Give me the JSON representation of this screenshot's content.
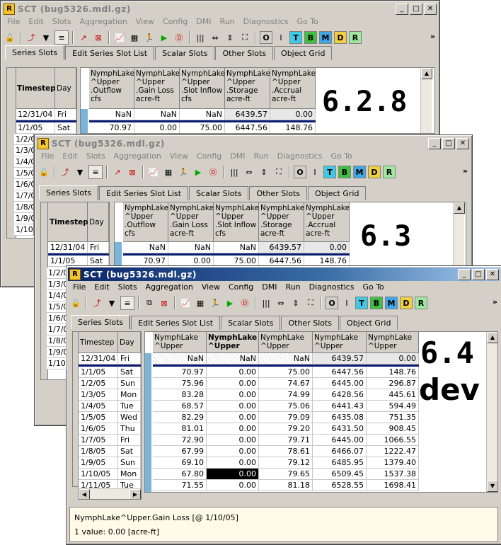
{
  "windows": {
    "w1": {
      "title": "SCT  (bug5326.mdl.gz)",
      "version": "6.2.8"
    },
    "w2": {
      "title": "SCT  (bug5326.mdl.gz)",
      "version": "6.3"
    },
    "w3": {
      "title": "SCT  (bug5326.mdl.gz)",
      "version_line1": "6.4",
      "version_line2": "dev"
    }
  },
  "menu": [
    "File",
    "Edit",
    "Slots",
    "Aggregation",
    "View",
    "Config",
    "DMI",
    "Run",
    "Diagnostics",
    "Go To"
  ],
  "toolbar_letters": [
    "O",
    "I",
    "T",
    "B",
    "M",
    "D",
    "R"
  ],
  "tabs": [
    "Series Slots",
    "Edit Series Slot List",
    "Scalar Slots",
    "Other Slots",
    "Object Grid"
  ],
  "old_headers": {
    "timestep": "Timestep",
    "day": "Day",
    "cols": [
      "NymphLake\n^Upper\n.Outflow\ncfs",
      "NymphLake\n^Upper\n.Gain Loss\nacre-ft",
      "NymphLake\n^Upper\n.Slot Inflow\ncfs",
      "NymphLake\n^Upper\n.Storage\nacre-ft",
      "NymphLake\n^Upper\n.Accrual\nacre-ft"
    ]
  },
  "new_headers": {
    "timestep": "Timestep",
    "day": "Day",
    "cols": [
      "NymphLake\n^Upper",
      "NymphLake\n^Upper",
      "NymphLake\n^Upper",
      "NymphLake\n^Upper",
      "NymphLake\n^Upper"
    ]
  },
  "rows": [
    {
      "ts": "12/31/04",
      "day": "Fri",
      "v": [
        "NaN",
        "NaN",
        "NaN",
        "6439.57",
        "0.00"
      ]
    },
    {
      "ts": "1/1/05",
      "day": "Sat",
      "v": [
        "70.97",
        "0.00",
        "75.00",
        "6447.56",
        "148.76"
      ]
    },
    {
      "ts": "1/2/05",
      "day": "Sun",
      "v": [
        "75.96",
        "0.00",
        "74.67",
        "6445.00",
        "296.87"
      ]
    },
    {
      "ts": "1/3/05",
      "day": "Mon",
      "v": [
        "83.28",
        "0.00",
        "74.99",
        "6428.56",
        "445.61"
      ]
    },
    {
      "ts": "1/4/05",
      "day": "Tue",
      "v": [
        "68.57",
        "0.00",
        "75.06",
        "6441.43",
        "594.49"
      ]
    },
    {
      "ts": "1/5/05",
      "day": "Wed",
      "v": [
        "82.29",
        "0.00",
        "79.09",
        "6435.08",
        "751.35"
      ]
    },
    {
      "ts": "1/6/05",
      "day": "Thu",
      "v": [
        "81.01",
        "0.00",
        "79.20",
        "6431.50",
        "908.45"
      ]
    },
    {
      "ts": "1/7/05",
      "day": "Fri",
      "v": [
        "72.90",
        "0.00",
        "79.71",
        "6445.00",
        "1066.55"
      ]
    },
    {
      "ts": "1/8/05",
      "day": "Sat",
      "v": [
        "67.99",
        "0.00",
        "78.61",
        "6466.07",
        "1222.47"
      ]
    },
    {
      "ts": "1/9/05",
      "day": "Sun",
      "v": [
        "69.10",
        "0.00",
        "79.12",
        "6485.95",
        "1379.40"
      ]
    },
    {
      "ts": "1/10/05",
      "day": "Mon",
      "v": [
        "67.80",
        "0.00",
        "79.65",
        "6509.45",
        "1537.38"
      ]
    },
    {
      "ts": "1/11/05",
      "day": "Tue",
      "v": [
        "71.55",
        "0.00",
        "81.18",
        "6528.55",
        "1698.41"
      ]
    }
  ],
  "old_row_labels": [
    "1/2/0",
    "1/3/0",
    "1/4/0",
    "1/5/0",
    "1/6/0",
    "1/7/0",
    "1/8/0",
    "1/9/0",
    "1/10"
  ],
  "mid_row_labels": [
    "1/2/0",
    "1/3/0",
    "1/4/0",
    "1/5/0",
    "1/6/0",
    "1/7/0",
    "1/8/0",
    "1/9/0",
    "1/10"
  ],
  "status": {
    "line1": "NymphLake^Upper.Gain Loss [@ 1/10/05]",
    "line2": "1 value:  0.00 [acre-ft]"
  },
  "colors": {
    "letter_T": "#40c8e8",
    "letter_B": "#40c040",
    "letter_M": "#40a8e8",
    "letter_D": "#f0d040",
    "letter_R": "#a0e8a0"
  }
}
